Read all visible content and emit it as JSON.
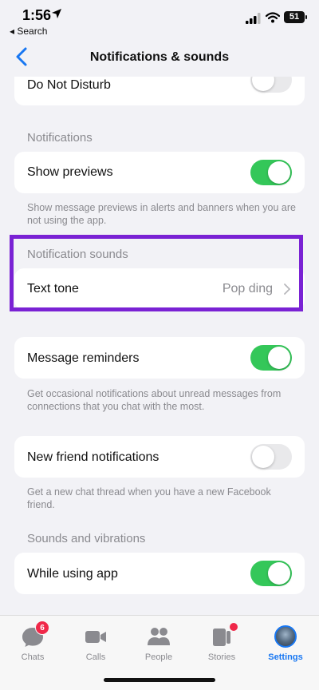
{
  "status_bar": {
    "time": "1:56",
    "back_app": "◂ Search",
    "battery": "51"
  },
  "nav": {
    "title": "Notifications & sounds"
  },
  "rows": {
    "do_not_disturb": {
      "label": "Do Not Disturb",
      "on": false
    },
    "notifications_header": "Notifications",
    "show_previews": {
      "label": "Show previews",
      "on": true
    },
    "show_previews_note": "Show message previews in alerts and banners when you are not using the app.",
    "notification_sounds_header": "Notification sounds",
    "text_tone": {
      "label": "Text tone",
      "value": "Pop ding"
    },
    "message_reminders": {
      "label": "Message reminders",
      "on": true
    },
    "message_reminders_note": "Get occasional notifications about unread messages from connections that you chat with the most.",
    "new_friend": {
      "label": "New friend notifications",
      "on": false
    },
    "new_friend_note": "Get a new chat thread when you have a new Facebook friend.",
    "sounds_header": "Sounds and vibrations",
    "while_using": {
      "label": "While using app",
      "on": true
    }
  },
  "tabs": [
    {
      "label": "Chats",
      "icon": "chat-bubble-icon",
      "badge": "6"
    },
    {
      "label": "Calls",
      "icon": "video-camera-icon"
    },
    {
      "label": "People",
      "icon": "people-icon"
    },
    {
      "label": "Stories",
      "icon": "stories-icon",
      "dot": true
    },
    {
      "label": "Settings",
      "icon": "avatar",
      "active": true
    }
  ],
  "colors": {
    "toggle_on": "#34c759",
    "toggle_off": "#e9e9eb",
    "accent": "#1877f2",
    "highlight": "#7a22d4",
    "badge": "#f02849"
  }
}
